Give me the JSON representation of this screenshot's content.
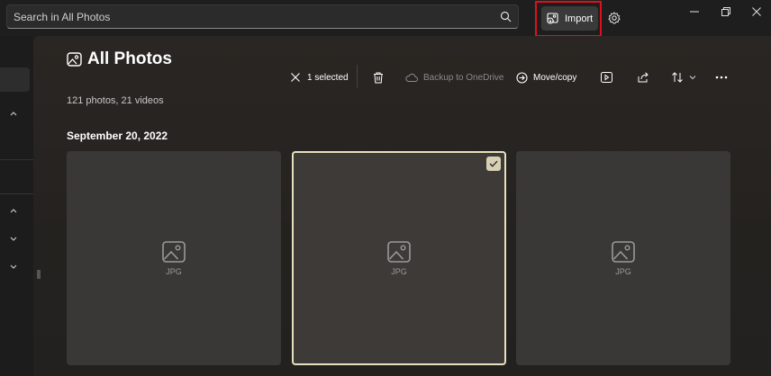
{
  "search": {
    "placeholder": "Search in All Photos"
  },
  "titlebar": {
    "import_label": "Import"
  },
  "header": {
    "title": "All Photos",
    "subtitle": "121 photos, 21 videos"
  },
  "toolbar": {
    "selected_label": "1 selected",
    "backup_label": "Backup to OneDrive",
    "movecopy_label": "Move/copy"
  },
  "gallery": {
    "date": "September 20, 2022",
    "tiles": [
      {
        "label": "JPG",
        "selected": false
      },
      {
        "label": "JPG",
        "selected": true
      },
      {
        "label": "JPG",
        "selected": false
      }
    ]
  },
  "icons": {
    "search": "search-icon",
    "import": "import-icon",
    "settings": "gear-icon",
    "minimize": "minimize-icon",
    "restore": "restore-icon",
    "close": "close-icon",
    "photos": "photos-icon",
    "clear_selection": "close-icon",
    "delete": "trash-icon",
    "backup": "cloud-icon",
    "move": "arrow-right-circle-icon",
    "slideshow": "play-icon",
    "share": "share-icon",
    "sort": "sort-icon",
    "more": "more-icon",
    "image": "image-placeholder-icon"
  },
  "colors": {
    "highlight": "#e0101b",
    "selection_border": "#e8dfbf",
    "tile": "#3a3836"
  }
}
